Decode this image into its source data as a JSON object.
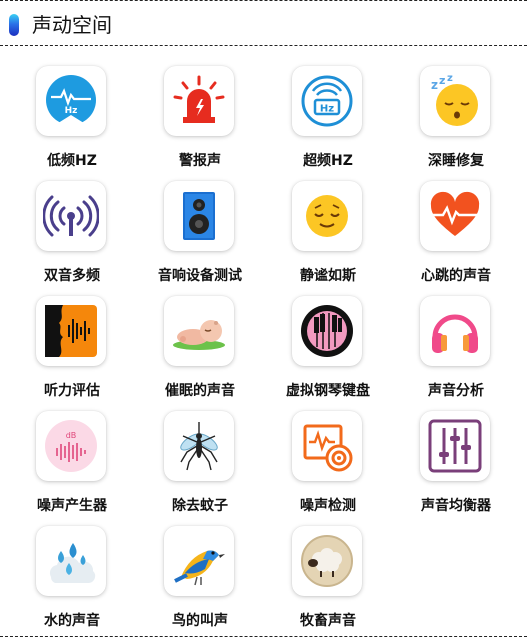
{
  "header": {
    "title": "声动空间"
  },
  "items": [
    {
      "label": "低频HZ",
      "icon": "low-frequency-hz-icon"
    },
    {
      "label": "警报声",
      "icon": "alarm-siren-icon"
    },
    {
      "label": "超频HZ",
      "icon": "high-frequency-hz-icon"
    },
    {
      "label": "深睡修复",
      "icon": "sleeping-face-icon"
    },
    {
      "label": "双音多频",
      "icon": "dual-tone-waves-icon"
    },
    {
      "label": "音响设备测试",
      "icon": "speaker-icon"
    },
    {
      "label": "静谧如斯",
      "icon": "relieved-face-icon"
    },
    {
      "label": "心跳的声音",
      "icon": "heartbeat-icon"
    },
    {
      "label": "听力评估",
      "icon": "hearing-assessment-icon"
    },
    {
      "label": "催眠的声音",
      "icon": "sleeping-baby-icon"
    },
    {
      "label": "虚拟钢琴键盘",
      "icon": "piano-keyboard-icon"
    },
    {
      "label": "声音分析",
      "icon": "headphones-icon"
    },
    {
      "label": "噪声产生器",
      "icon": "noise-db-icon"
    },
    {
      "label": "除去蚊子",
      "icon": "mosquito-icon"
    },
    {
      "label": "噪声检测",
      "icon": "noise-detection-icon"
    },
    {
      "label": "声音均衡器",
      "icon": "equalizer-icon"
    },
    {
      "label": "水的声音",
      "icon": "water-drops-icon"
    },
    {
      "label": "鸟的叫声",
      "icon": "bird-icon"
    },
    {
      "label": "牧畜声音",
      "icon": "sheep-icon"
    }
  ]
}
